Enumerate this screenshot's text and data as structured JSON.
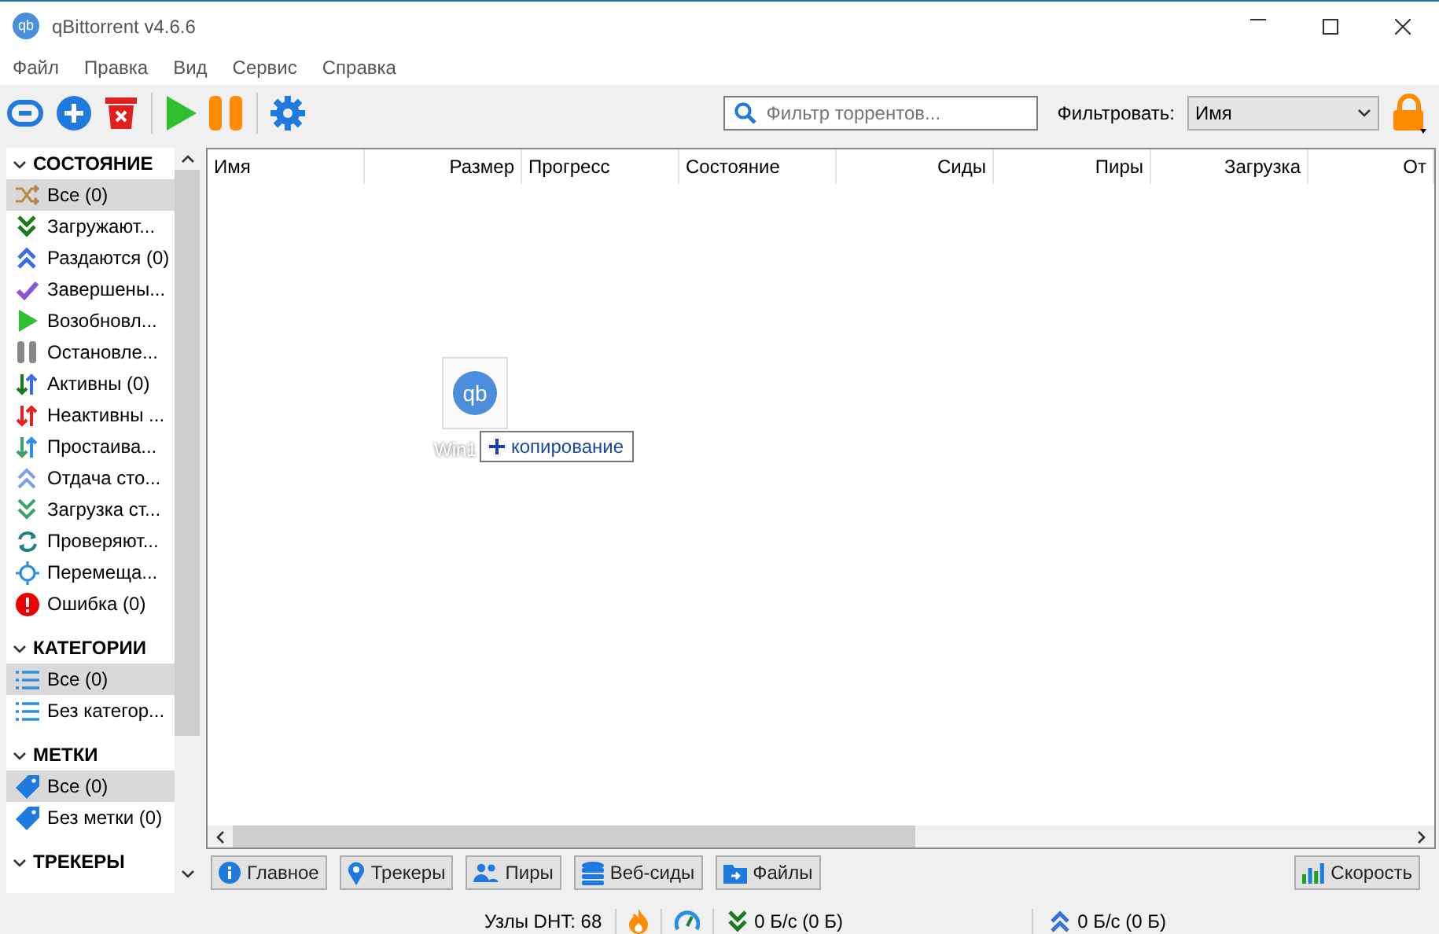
{
  "window": {
    "title": "qBittorrent v4.6.6",
    "logo_text": "qb"
  },
  "menu": [
    "Файл",
    "Правка",
    "Вид",
    "Сервис",
    "Справка"
  ],
  "search": {
    "placeholder": "Фильтр торрентов..."
  },
  "filter": {
    "label": "Фильтровать:",
    "value": "Имя"
  },
  "sidebar": [
    {
      "title": "СОСТОЯНИЕ",
      "expanded": true,
      "items": [
        {
          "label": "Все (0)",
          "selected": true
        },
        {
          "label": "Загружают...",
          "selected": false
        },
        {
          "label": "Раздаются (0)",
          "selected": false
        },
        {
          "label": "Завершены...",
          "selected": false
        },
        {
          "label": "Возобновл...",
          "selected": false
        },
        {
          "label": "Остановле...",
          "selected": false
        },
        {
          "label": "Активны (0)",
          "selected": false
        },
        {
          "label": "Неактивны ...",
          "selected": false
        },
        {
          "label": "Простаива...",
          "selected": false
        },
        {
          "label": "Отдача сто...",
          "selected": false
        },
        {
          "label": "Загрузка ст...",
          "selected": false
        },
        {
          "label": "Проверяют...",
          "selected": false
        },
        {
          "label": "Перемеща...",
          "selected": false
        },
        {
          "label": "Ошибка (0)",
          "selected": false
        }
      ]
    },
    {
      "title": "КАТЕГОРИИ",
      "expanded": true,
      "items": [
        {
          "label": "Все (0)",
          "selected": true
        },
        {
          "label": "Без категор...",
          "selected": false
        }
      ]
    },
    {
      "title": "МЕТКИ",
      "expanded": true,
      "items": [
        {
          "label": "Все (0)",
          "selected": true
        },
        {
          "label": "Без метки (0)",
          "selected": false
        }
      ]
    },
    {
      "title": "ТРЕКЕРЫ",
      "expanded": true
    }
  ],
  "table": {
    "columns": [
      "Имя",
      "Размер",
      "Прогресс",
      "Состояние",
      "Сиды",
      "Пиры",
      "Загрузка",
      "От"
    ]
  },
  "drag": {
    "file_label": "Win1",
    "logo_text": "qb",
    "action": "копирование"
  },
  "bottom_tabs": [
    "Главное",
    "Трекеры",
    "Пиры",
    "Веб-сиды",
    "Файлы"
  ],
  "speed_button": "Скорость",
  "status_bar": {
    "dht": "Узлы DHT: 68",
    "download": "0 Б/с (0 Б)",
    "upload": "0 Б/с (0 Б)"
  }
}
